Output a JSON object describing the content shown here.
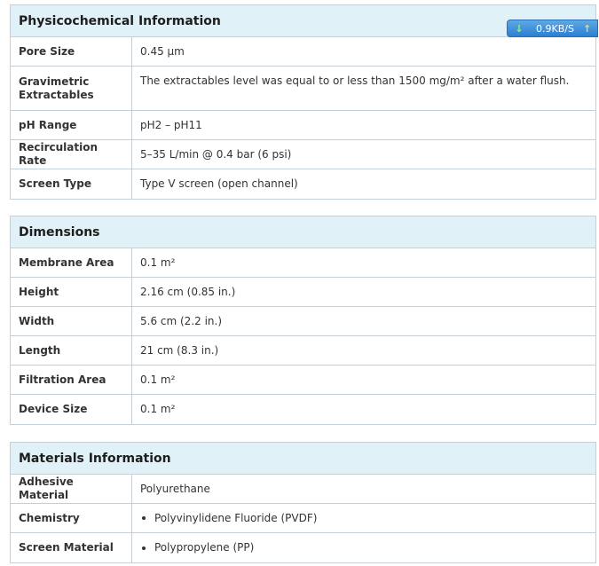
{
  "physicochemical": {
    "title": "Physicochemical Information",
    "rows": [
      {
        "label": "Pore Size",
        "value": "0.45 µm"
      },
      {
        "label": "Gravimetric Extractables",
        "value": "The extractables level was equal to or less than 1500 mg/m² after a water flush."
      },
      {
        "label": "pH Range",
        "value": "pH2 – pH11"
      },
      {
        "label": "Recirculation Rate",
        "value": "5–35 L/min @ 0.4 bar (6 psi)"
      },
      {
        "label": "Screen Type",
        "value": "Type V screen (open channel)"
      }
    ]
  },
  "dimensions": {
    "title": "Dimensions",
    "rows": [
      {
        "label": "Membrane Area",
        "value": "0.1 m²"
      },
      {
        "label": "Height",
        "value": "2.16 cm (0.85 in.)"
      },
      {
        "label": "Width",
        "value": "5.6 cm (2.2 in.)"
      },
      {
        "label": "Length",
        "value": "21 cm (8.3 in.)"
      },
      {
        "label": "Filtration Area",
        "value": "0.1 m²"
      },
      {
        "label": "Device Size",
        "value": "0.1 m²"
      }
    ]
  },
  "materials": {
    "title": "Materials Information",
    "rows": [
      {
        "label": "Adhesive Material",
        "value": "Polyurethane"
      },
      {
        "label": "Chemistry",
        "value": "Polyvinylidene Fluoride (PVDF)"
      },
      {
        "label": "Screen Material",
        "value": "Polypropylene (PP)"
      }
    ]
  },
  "speed_widget": {
    "down_icon": "down-arrow-icon",
    "rate": "0.9KB/S",
    "up_icon": "up-arrow-icon"
  }
}
